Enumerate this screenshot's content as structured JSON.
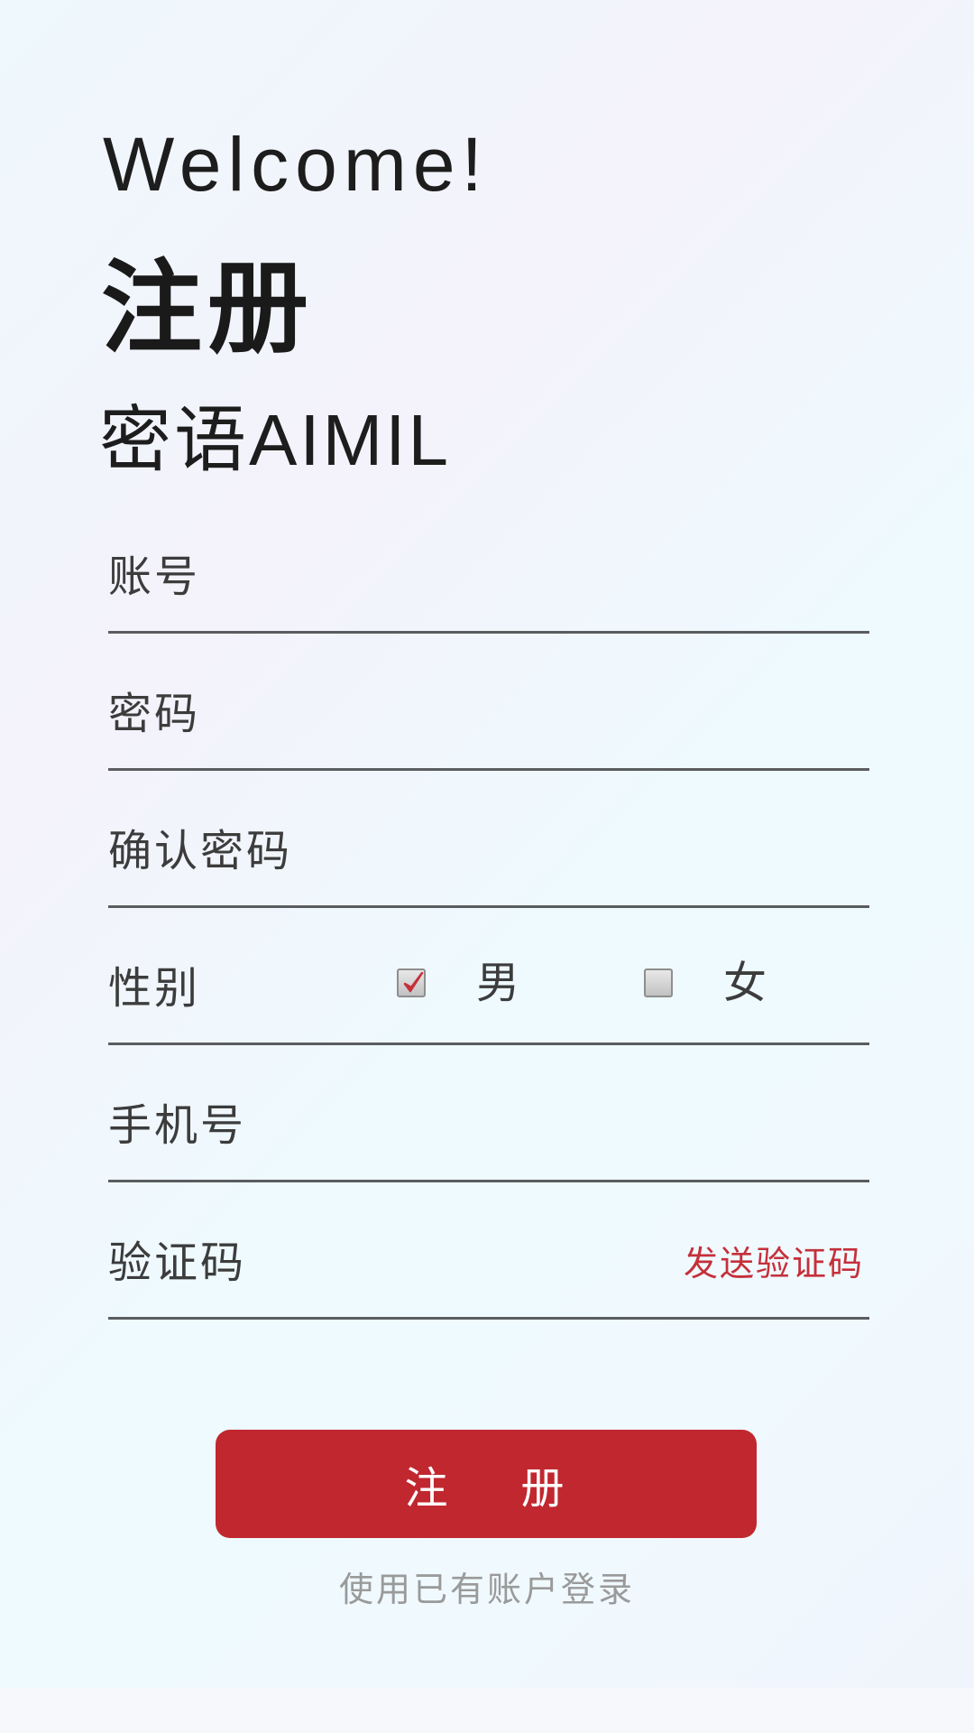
{
  "header": {
    "welcome": "Welcome!",
    "title": "注册",
    "app_name": "密语AIMIL"
  },
  "form": {
    "account_label": "账号",
    "password_label": "密码",
    "confirm_password_label": "确认密码",
    "gender": {
      "label": "性别",
      "male": "男",
      "female": "女",
      "selected": "男"
    },
    "phone_label": "手机号",
    "code_label": "验证码",
    "send_code_label": "发送验证码"
  },
  "actions": {
    "register_label": "注    册",
    "login_link": "使用已有账户登录"
  },
  "colors": {
    "accent": "#c1272f",
    "link": "#c5303a",
    "check": "#c5303a"
  }
}
